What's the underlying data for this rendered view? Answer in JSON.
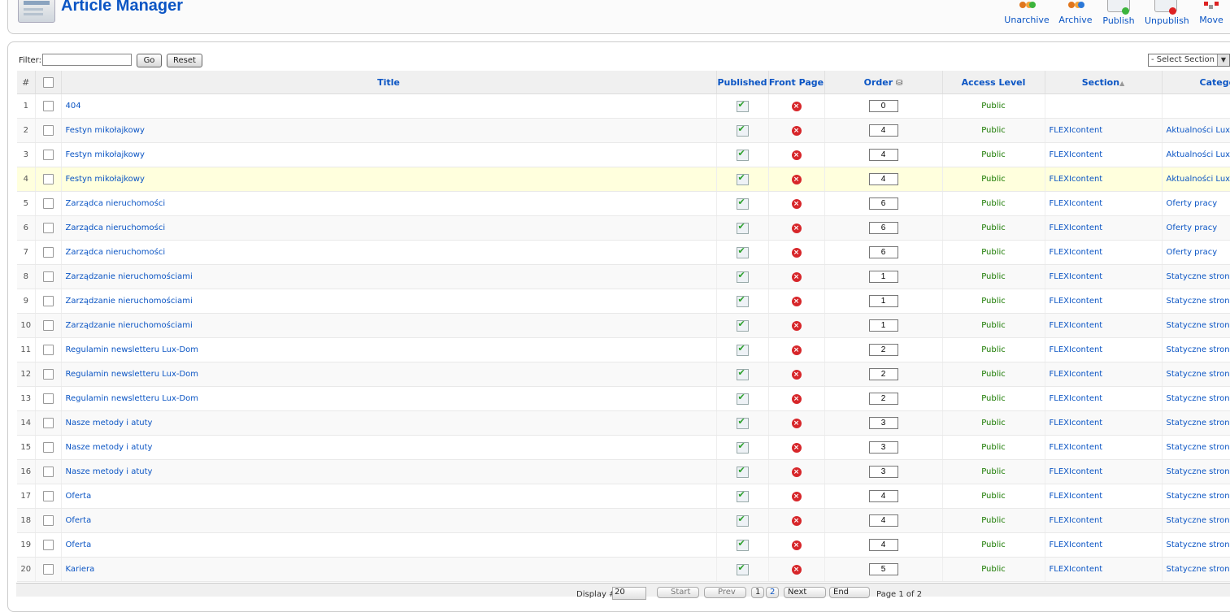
{
  "header": {
    "title": "Article Manager"
  },
  "toolbar": {
    "buttons": [
      {
        "label": "Unarchive"
      },
      {
        "label": "Archive"
      },
      {
        "label": "Publish"
      },
      {
        "label": "Unpublish"
      },
      {
        "label": "Move"
      }
    ]
  },
  "filter": {
    "label": "Filter:",
    "value": "",
    "go_label": "Go",
    "reset_label": "Reset"
  },
  "section_select": {
    "selected": "- Select Section -"
  },
  "table": {
    "columns": {
      "num": "#",
      "title": "Title",
      "published": "Published",
      "front_page": "Front Page",
      "order": "Order",
      "access": "Access Level",
      "section": "Section",
      "category": "Category"
    },
    "rows": [
      {
        "num": "1",
        "title": "404",
        "order": "0",
        "access": "Public",
        "section": "",
        "category": ""
      },
      {
        "num": "2",
        "title": "Festyn mikołajkowy",
        "order": "4",
        "access": "Public",
        "section": "FLEXIcontent",
        "category": "Aktualności Lux-Dom"
      },
      {
        "num": "3",
        "title": "Festyn mikołajkowy",
        "order": "4",
        "access": "Public",
        "section": "FLEXIcontent",
        "category": "Aktualności Lux-Dom"
      },
      {
        "num": "4",
        "title": "Festyn mikołajkowy",
        "order": "4",
        "access": "Public",
        "section": "FLEXIcontent",
        "category": "Aktualności Lux-Dom"
      },
      {
        "num": "5",
        "title": "Zarządca nieruchomości",
        "order": "6",
        "access": "Public",
        "section": "FLEXIcontent",
        "category": "Oferty pracy"
      },
      {
        "num": "6",
        "title": "Zarządca nieruchomości",
        "order": "6",
        "access": "Public",
        "section": "FLEXIcontent",
        "category": "Oferty pracy"
      },
      {
        "num": "7",
        "title": "Zarządca nieruchomości",
        "order": "6",
        "access": "Public",
        "section": "FLEXIcontent",
        "category": "Oferty pracy"
      },
      {
        "num": "8",
        "title": "Zarządzanie nieruchomościami",
        "order": "1",
        "access": "Public",
        "section": "FLEXIcontent",
        "category": "Statyczne strony"
      },
      {
        "num": "9",
        "title": "Zarządzanie nieruchomościami",
        "order": "1",
        "access": "Public",
        "section": "FLEXIcontent",
        "category": "Statyczne strony"
      },
      {
        "num": "10",
        "title": "Zarządzanie nieruchomościami",
        "order": "1",
        "access": "Public",
        "section": "FLEXIcontent",
        "category": "Statyczne strony"
      },
      {
        "num": "11",
        "title": "Regulamin newsletteru Lux-Dom",
        "order": "2",
        "access": "Public",
        "section": "FLEXIcontent",
        "category": "Statyczne strony"
      },
      {
        "num": "12",
        "title": "Regulamin newsletteru Lux-Dom",
        "order": "2",
        "access": "Public",
        "section": "FLEXIcontent",
        "category": "Statyczne strony"
      },
      {
        "num": "13",
        "title": "Regulamin newsletteru Lux-Dom",
        "order": "2",
        "access": "Public",
        "section": "FLEXIcontent",
        "category": "Statyczne strony"
      },
      {
        "num": "14",
        "title": "Nasze metody i atuty",
        "order": "3",
        "access": "Public",
        "section": "FLEXIcontent",
        "category": "Statyczne strony"
      },
      {
        "num": "15",
        "title": "Nasze metody i atuty",
        "order": "3",
        "access": "Public",
        "section": "FLEXIcontent",
        "category": "Statyczne strony"
      },
      {
        "num": "16",
        "title": "Nasze metody i atuty",
        "order": "3",
        "access": "Public",
        "section": "FLEXIcontent",
        "category": "Statyczne strony"
      },
      {
        "num": "17",
        "title": "Oferta",
        "order": "4",
        "access": "Public",
        "section": "FLEXIcontent",
        "category": "Statyczne strony"
      },
      {
        "num": "18",
        "title": "Oferta",
        "order": "4",
        "access": "Public",
        "section": "FLEXIcontent",
        "category": "Statyczne strony"
      },
      {
        "num": "19",
        "title": "Oferta",
        "order": "4",
        "access": "Public",
        "section": "FLEXIcontent",
        "category": "Statyczne strony"
      },
      {
        "num": "20",
        "title": "Kariera",
        "order": "5",
        "access": "Public",
        "section": "FLEXIcontent",
        "category": "Statyczne strony"
      }
    ]
  },
  "pagination": {
    "display_label": "Display #",
    "display_value": "20",
    "start": "Start",
    "prev": "Prev",
    "page1": "1",
    "page2": "2",
    "next": "Next",
    "end": "End",
    "page_info": "Page 1 of 2"
  },
  "colors": {
    "link": "#0b55c4",
    "public": "#1a7a00",
    "highlight_row": "#ffffdd"
  }
}
